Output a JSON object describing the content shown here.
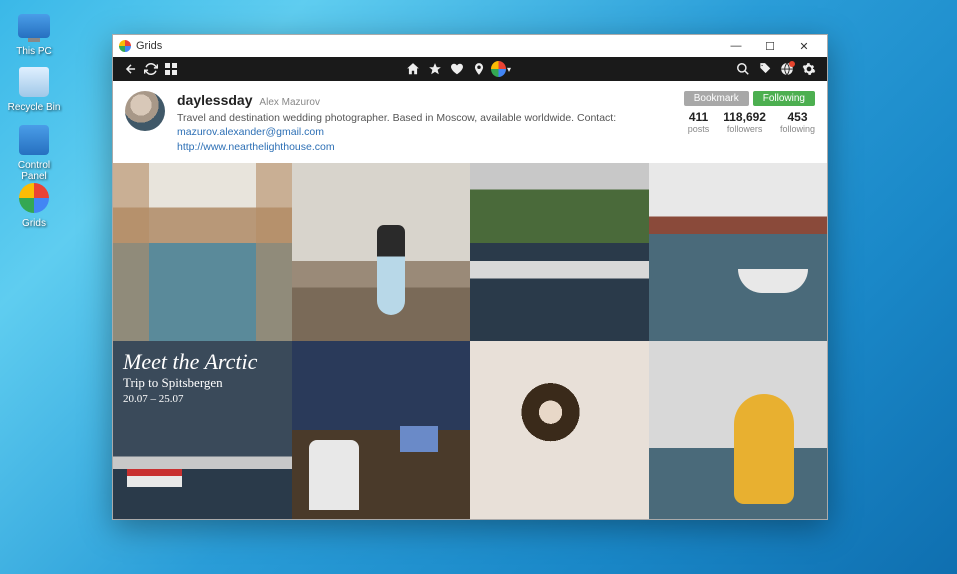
{
  "desktop": {
    "icons": [
      {
        "name": "this-pc",
        "label": "This PC"
      },
      {
        "name": "recycle-bin",
        "label": "Recycle Bin"
      },
      {
        "name": "control-panel",
        "label": "Control Panel"
      },
      {
        "name": "grids-app",
        "label": "Grids"
      }
    ]
  },
  "window": {
    "title": "Grids"
  },
  "profile": {
    "username": "daylessday",
    "realname": "Alex Mazurov",
    "bio_prefix": "Travel and destination wedding photographer. Based in Moscow, available worldwide. Contact: ",
    "email": "mazurov.alexander@gmail.com",
    "website": "http://www.nearthelighthouse.com",
    "bookmark_label": "Bookmark",
    "following_label": "Following",
    "stats": {
      "posts": {
        "value": "411",
        "label": "posts"
      },
      "followers": {
        "value": "118,692",
        "label": "followers"
      },
      "following": {
        "value": "453",
        "label": "following"
      }
    }
  },
  "arctic_post": {
    "title": "Meet the Arctic",
    "subtitle": "Trip to Spitsbergen",
    "dates": "20.07 – 25.07"
  }
}
